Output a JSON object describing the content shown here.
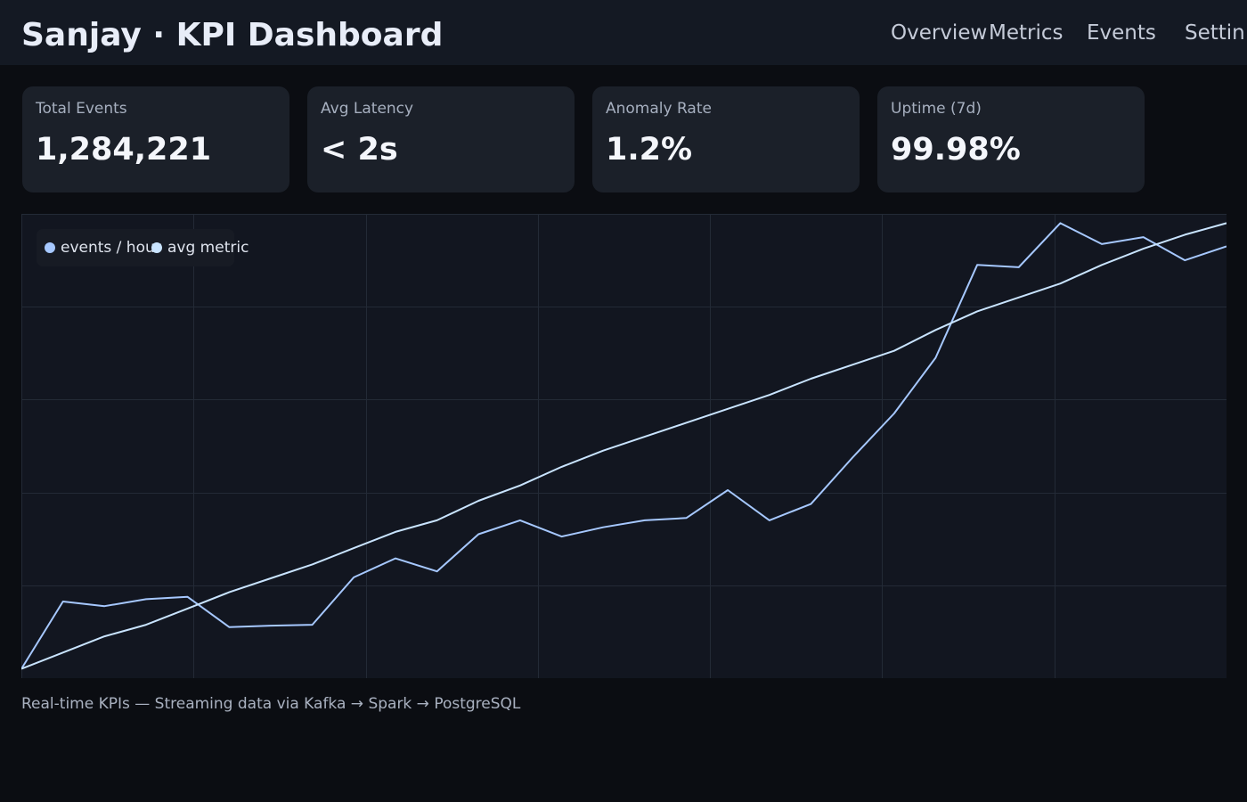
{
  "header": {
    "title": "Sanjay · KPI Dashboard",
    "nav": [
      "Overview",
      "Metrics",
      "Events",
      "Settin"
    ]
  },
  "kpis": [
    {
      "label": "Total Events",
      "value": "1,284,221"
    },
    {
      "label": "Avg Latency",
      "value": "< 2s"
    },
    {
      "label": "Anomaly Rate",
      "value": "1.2%"
    },
    {
      "label": "Uptime (7d)",
      "value": "99.98%"
    }
  ],
  "footer": {
    "caption": "Real-time KPIs — Streaming data via Kafka → Spark → PostgreSQL"
  },
  "colors": {
    "series_primary": "#a6c8ff",
    "series_secondary": "#c9e4ff",
    "grid": "#232a36"
  },
  "chart_data": {
    "type": "line",
    "title": "",
    "xlabel": "",
    "ylabel": "",
    "grid": true,
    "legend": "top-left",
    "x": [
      0,
      1,
      2,
      3,
      4,
      5,
      6,
      7,
      8,
      9,
      10,
      11,
      12,
      13,
      14,
      15,
      16,
      17,
      18,
      19,
      20,
      21,
      22,
      23,
      24,
      25,
      26,
      27,
      28,
      29
    ],
    "xlim": [
      0,
      29
    ],
    "ylim": [
      0,
      100
    ],
    "series": [
      {
        "name": "events / hour",
        "color": "#a6c8ff",
        "values": [
          2,
          16.5,
          15.5,
          17,
          17.5,
          11,
          11.3,
          11.5,
          21.7,
          25.8,
          23,
          31,
          34,
          30.5,
          32.5,
          34,
          34.5,
          40.5,
          34,
          37.5,
          47.5,
          57,
          69,
          89,
          88.5,
          98,
          93.5,
          95,
          90,
          93
        ]
      },
      {
        "name": "avg metric",
        "color": "#c9e4ff",
        "values": [
          2,
          5.5,
          9,
          11.5,
          15,
          18.5,
          21.5,
          24.5,
          28,
          31.5,
          34,
          38.2,
          41.5,
          45.5,
          49,
          52,
          55,
          58,
          61,
          64.5,
          67.5,
          70.5,
          75,
          79,
          82,
          85,
          89,
          92.5,
          95.5,
          98
        ]
      }
    ]
  }
}
